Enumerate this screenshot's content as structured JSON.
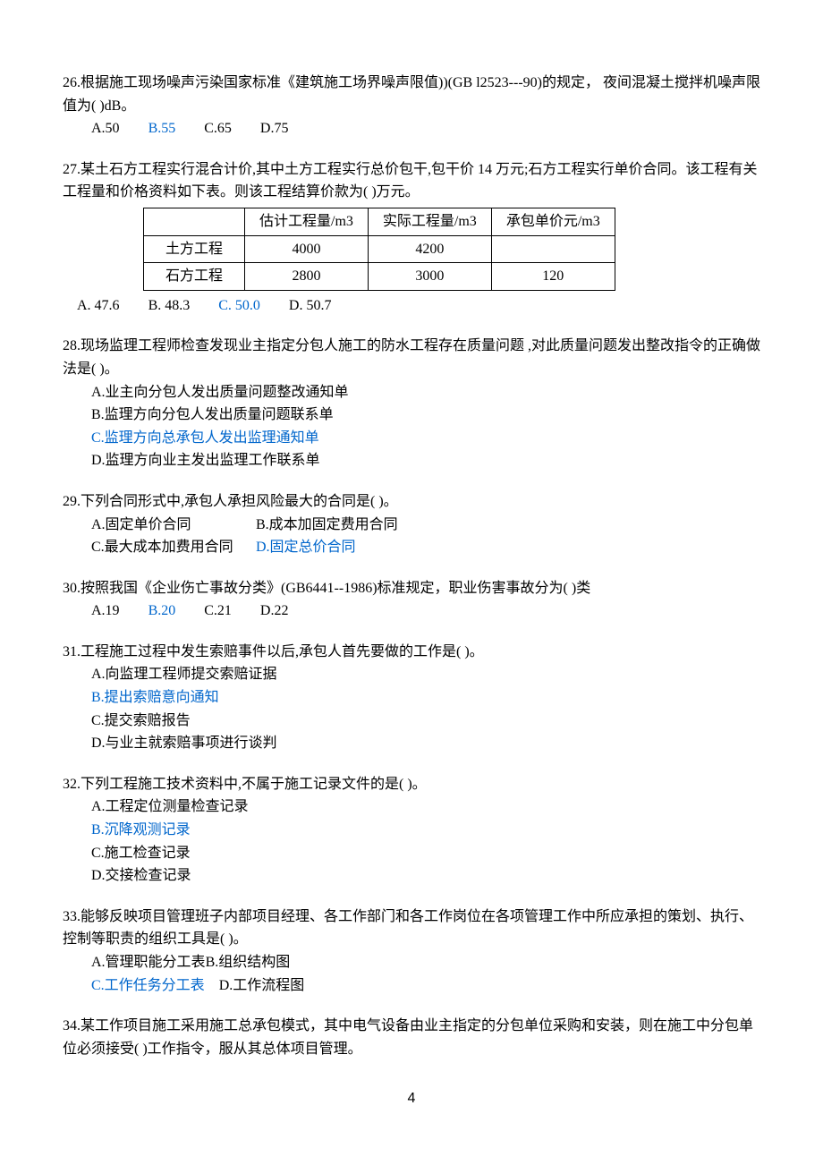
{
  "q26": {
    "stem": "26.根据施工现场噪声污染国家标准《建筑施工场界噪声限值))(GB l2523---90)的规定，  夜间混凝土搅拌机噪声限值为(      )dB。",
    "optA": "A.50",
    "optB": "B.55",
    "optC": "C.65",
    "optD": "D.75"
  },
  "q27": {
    "stem1": "27.某土石方工程实行混合计价,其中土方工程实行总价包干,包干价  14  万元;石方工程实行单价合同。该工程有关工程量和价格资料如下表。则该工程结算价款为(      )万元。",
    "table": {
      "h1": "",
      "h2": "估计工程量/m3",
      "h3": "实际工程量/m3",
      "h4": "承包单价元/m3",
      "r1c1": "土方工程",
      "r1c2": "4000",
      "r1c3": "4200",
      "r1c4": "",
      "r2c1": "石方工程",
      "r2c2": "2800",
      "r2c3": "3000",
      "r2c4": "120"
    },
    "optA": "A. 47.6",
    "optB": "B. 48.3",
    "optC": "C. 50.0",
    "optD": "D. 50.7"
  },
  "q28": {
    "stem": "28.现场监理工程师检查发现业主指定分包人施工的防水工程存在质量问题 ,对此质量问题发出整改指令的正确做法是(      )。",
    "optA": "A.业主向分包人发出质量问题整改通知单",
    "optB": "B.监理方向分包人发出质量问题联系单",
    "optC": "C.监理方向总承包人发出监理通知单",
    "optD": "D.监理方向业主发出监理工作联系单"
  },
  "q29": {
    "stem": "29.下列合同形式中,承包人承担风险最大的合同是(    )。",
    "optA": "A.固定单价合同",
    "optB": "B.成本加固定费用合同",
    "optC": "C.最大成本加费用合同",
    "optD": "D.固定总价合同"
  },
  "q30": {
    "stem": "30.按照我国《企业伤亡事故分类》(GB6441--1986)标准规定，职业伤害事故分为(  )类",
    "optA": "A.19",
    "optB": "B.20",
    "optC": "C.21",
    "optD": "D.22"
  },
  "q31": {
    "stem": "31.工程施工过程中发生索赔事件以后,承包人首先要做的工作是(    )。",
    "optA": "A.向监理工程师提交索赔证据",
    "optB": "B.提出索赔意向通知",
    "optC": "C.提交索赔报告",
    "optD": "D.与业主就索赔事项进行谈判"
  },
  "q32": {
    "stem": "32.下列工程施工技术资料中,不属于施工记录文件的是(    )。",
    "optA": "A.工程定位测量检查记录",
    "optB": "B.沉降观测记录",
    "optC": "C.施工检查记录",
    "optD": "D.交接检查记录"
  },
  "q33": {
    "stem": "33.能够反映项目管理班子内部项目经理、各工作部门和各工作岗位在各项管理工作中所应承担的策划、执行、控制等职责的组织工具是(       )。",
    "optA": "A.管理职能分工表",
    "optB": "B.组织结构图",
    "optC": "C.工作任务分工表",
    "optD": "D.工作流程图"
  },
  "q34": {
    "stem": "34.某工作项目施工采用施工总承包模式，其中电气设备由业主指定的分包单位采购和安装，则在施工中分包单位必须接受(    )工作指令，服从其总体项目管理。"
  },
  "page": "4"
}
